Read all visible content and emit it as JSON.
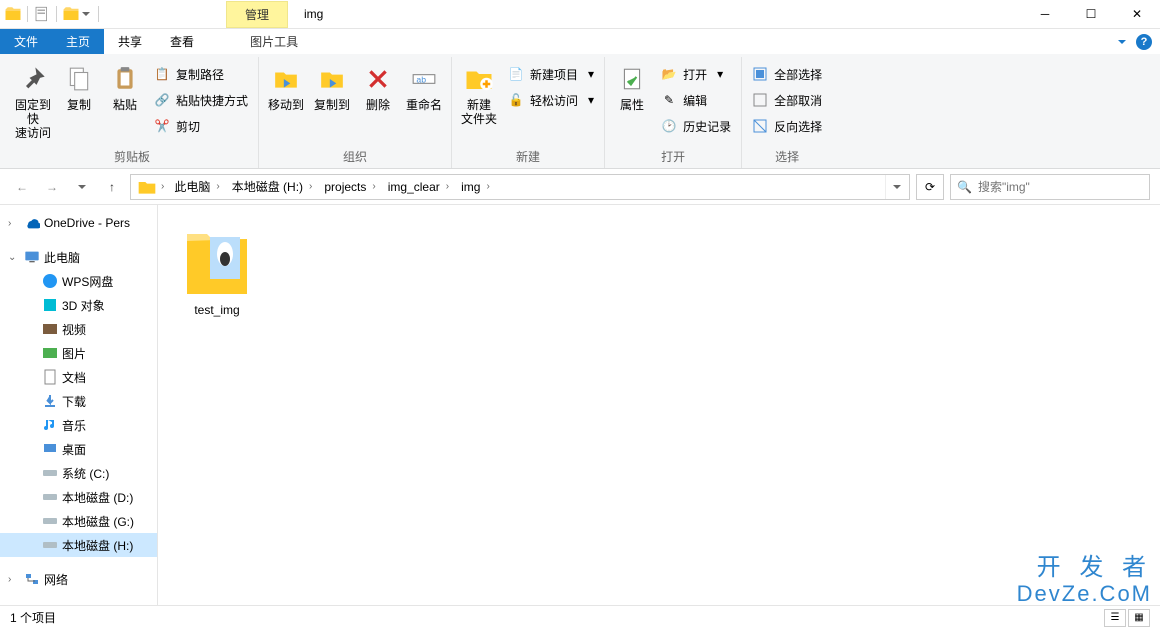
{
  "titlebar": {
    "context_tab": "管理",
    "title": "img"
  },
  "tabs": {
    "file": "文件",
    "home": "主页",
    "share": "共享",
    "view": "查看",
    "picture_tools": "图片工具"
  },
  "ribbon": {
    "clipboard": {
      "pin": "固定到快\n速访问",
      "copy": "复制",
      "paste": "粘贴",
      "copy_path": "复制路径",
      "paste_shortcut": "粘贴快捷方式",
      "cut": "剪切",
      "label": "剪贴板"
    },
    "organize": {
      "move_to": "移动到",
      "copy_to": "复制到",
      "delete": "删除",
      "rename": "重命名",
      "label": "组织"
    },
    "new": {
      "new_folder": "新建\n文件夹",
      "new_item": "新建项目",
      "easy_access": "轻松访问",
      "label": "新建"
    },
    "open": {
      "properties": "属性",
      "open": "打开",
      "edit": "编辑",
      "history": "历史记录",
      "label": "打开"
    },
    "select": {
      "select_all": "全部选择",
      "select_none": "全部取消",
      "invert": "反向选择",
      "label": "选择"
    }
  },
  "breadcrumb": {
    "items": [
      "此电脑",
      "本地磁盘 (H:)",
      "projects",
      "img_clear",
      "img"
    ]
  },
  "search": {
    "placeholder": "搜索\"img\""
  },
  "sidebar": {
    "onedrive": "OneDrive - Pers",
    "this_pc": "此电脑",
    "items": [
      {
        "icon": "wps",
        "label": "WPS网盘"
      },
      {
        "icon": "3d",
        "label": "3D 对象"
      },
      {
        "icon": "video",
        "label": "视频"
      },
      {
        "icon": "pictures",
        "label": "图片"
      },
      {
        "icon": "documents",
        "label": "文档"
      },
      {
        "icon": "downloads",
        "label": "下载"
      },
      {
        "icon": "music",
        "label": "音乐"
      },
      {
        "icon": "desktop",
        "label": "桌面"
      },
      {
        "icon": "disk",
        "label": "系统 (C:)"
      },
      {
        "icon": "disk",
        "label": "本地磁盘 (D:)"
      },
      {
        "icon": "disk",
        "label": "本地磁盘 (G:)"
      },
      {
        "icon": "disk",
        "label": "本地磁盘 (H:)",
        "selected": true
      }
    ],
    "network": "网络"
  },
  "content": {
    "items": [
      {
        "name": "test_img",
        "type": "folder"
      }
    ]
  },
  "statusbar": {
    "count": "1 个项目"
  },
  "watermark": {
    "line1": "开 发 者",
    "line2": "DevZe.CoM"
  }
}
